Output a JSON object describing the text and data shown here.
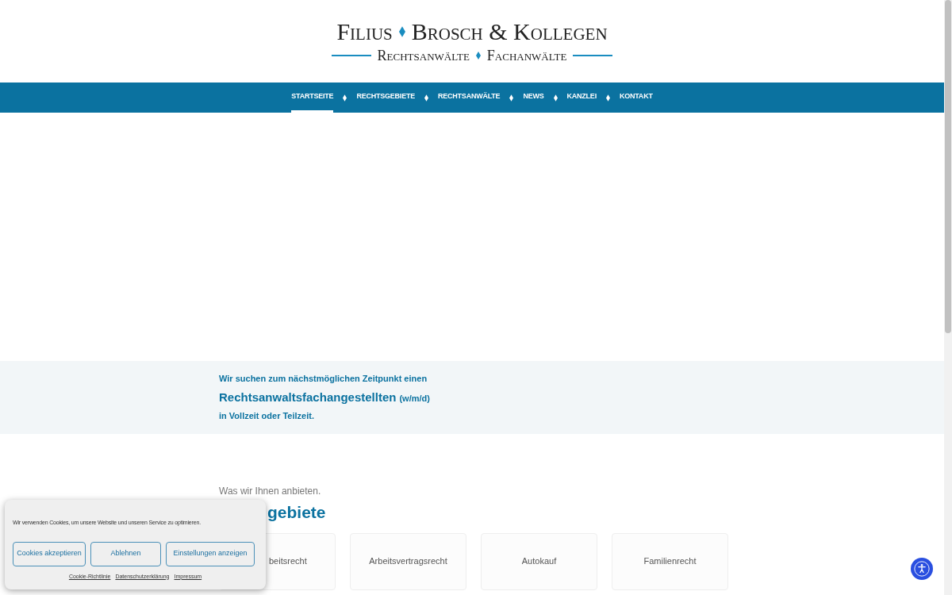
{
  "logo": {
    "line_1": [
      "Filius",
      "Brosch & Kollegen"
    ],
    "line_2": [
      "Rechtsanwälte",
      "Fachanwälte"
    ]
  },
  "nav": [
    {
      "label": "STARTSEITE",
      "selected": true
    },
    {
      "label": "RECHTSGEBIETE",
      "selected": false
    },
    {
      "label": "RECHTSANWÄLTE",
      "selected": false
    },
    {
      "label": "NEWS",
      "selected": false
    },
    {
      "label": "KANZLEI",
      "selected": false
    },
    {
      "label": "KONTAKT",
      "selected": false
    }
  ],
  "job_banner": {
    "line_1": "Wir suchen zum nächstmöglichen Zeitpunkt einen",
    "position": "Rechtsanwaltsfachangestellten",
    "suffix": "(w/m/d)",
    "line_3": "in Vollzeit oder Teilzeit."
  },
  "offer": {
    "kicker": "Was wir Ihnen anbieten.",
    "heading": "gebiete",
    "cards": [
      "beitsrecht",
      "Arbeitsvertragsrecht",
      "Autokauf",
      "Familienrecht"
    ]
  },
  "cookie_banner": {
    "message": "Wir verwenden Cookies, um unsere Website und unseren Service zu optimieren.",
    "buttons": [
      "Cookies akzeptieren",
      "Ablehnen",
      "Einstellungen anzeigen"
    ],
    "links": [
      "Cookie-Richtlinie",
      "Datenschutzerklärung",
      "Impressum"
    ]
  }
}
